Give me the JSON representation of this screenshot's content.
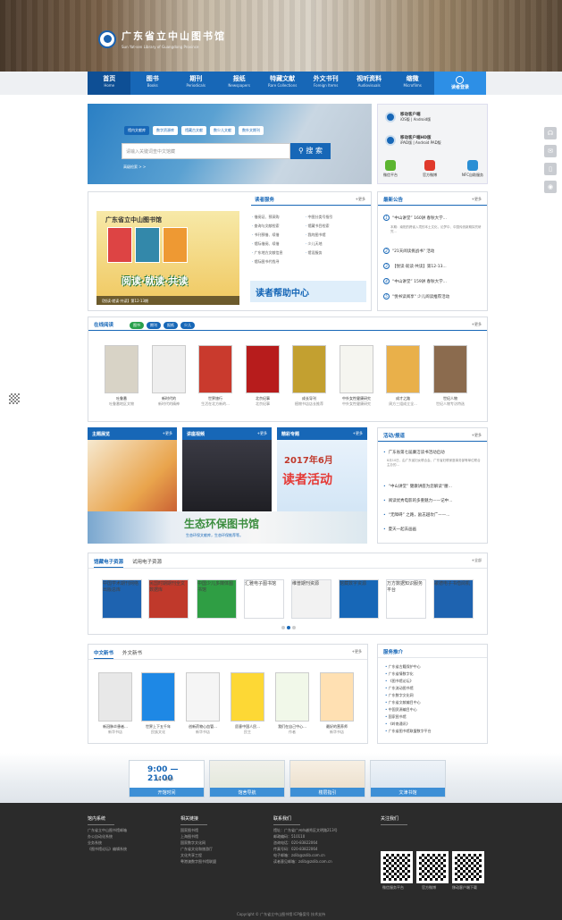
{
  "header": {
    "title": "广东省立中山图书馆",
    "subtitle": "Sun Yat-sen Library of Guangdong Province"
  },
  "nav": [
    {
      "cn": "首页",
      "en": "Home"
    },
    {
      "cn": "图书",
      "en": "Books"
    },
    {
      "cn": "期刊",
      "en": "Periodicals"
    },
    {
      "cn": "报纸",
      "en": "Newspapers"
    },
    {
      "cn": "特藏文献",
      "en": "Rare Collections"
    },
    {
      "cn": "外文书刊",
      "en": "Foreign Items"
    },
    {
      "cn": "视听资料",
      "en": "Audiovisuals"
    },
    {
      "cn": "缩微",
      "en": "Microfilms"
    },
    {
      "cn": "读者登录",
      "en": ""
    }
  ],
  "search": {
    "tabs": [
      "馆内文献库",
      "数字资源库",
      "馆藏古文献",
      "数少儿文献",
      "数外文期刊"
    ],
    "placeholder": "请输入关键词查中文馆藏",
    "button": "搜 索",
    "advanced": "高级检索 > >"
  },
  "mobile": {
    "phone_title": "移动客户端",
    "phone_sub": "iOS版 | Android版",
    "hd_title": "移动客户端HD版",
    "hd_sub": "iPAD版 | Android PAD版",
    "apps": [
      "微信平台",
      "官方微博",
      "NFC自助服务"
    ]
  },
  "reader_service": {
    "title": "读者服务",
    "more": "+更多",
    "banner_title": "广东省立中山图书馆",
    "banner_slogan": "阅读·就读·共读",
    "banner_caption": "【悦读·就读·共读】第12·13期",
    "links_left": [
      "借阅证、预采购",
      "查询与文献检索",
      "书刊预借、续借",
      "馆际借阅、续借",
      "广东地方文献信息",
      "馆际图书代找寻"
    ],
    "links_right": [
      "中图分类号指引",
      "馆藏书目检索",
      "我的图书馆",
      "少儿天地",
      "馆设服务"
    ],
    "help": "读者帮助中心"
  },
  "notices": {
    "title": "最新公告",
    "more": "+更多",
    "items": [
      "“中山讲堂” 160讲 春秋大学...",
      "\"21天阅读挑战书\" 活动",
      "【悦读·就读·共读】第12-13...",
      "“中山讲堂” 159讲 春秋大学...",
      "\"悦书读阅享\" 少儿阅读推荐活动"
    ],
    "snippet": "本期：南阳的跨省入境的本土文化，论梦中、中国传统新期探究研究..."
  },
  "online_reading": {
    "title": "在线阅读",
    "pills": [
      "图书",
      "期刊",
      "报纸",
      "少儿"
    ],
    "more": "+更多",
    "books": [
      {
        "t": "吐鲁番",
        "s": "吐鲁番地区文物"
      },
      {
        "t": "新时代的",
        "s": "新时代的精神"
      },
      {
        "t": "世界旅行",
        "s": "生活在北方新的..."
      },
      {
        "t": "北京纪事",
        "s": "北京纪事"
      },
      {
        "t": "成长导刊",
        "s": "植物书店店长推荐"
      },
      {
        "t": "中外女性健康研究",
        "s": "中外女性健康研究"
      },
      {
        "t": "成才之路",
        "s": "周方三组成立全..."
      },
      {
        "t": "世纪人物",
        "s": "世纪人物专访特选"
      }
    ]
  },
  "sections": {
    "theme": {
      "title": "主题展览",
      "more": "+更多",
      "caption": "喜迎新春——年画展示活动"
    },
    "video": {
      "title": "讲座视频",
      "more": "+更多",
      "time": "0:00"
    },
    "special": {
      "title": "精彩专题",
      "more": "+更多",
      "headline": "2017年6月",
      "big": "读者活动",
      "caption": "6月读者活动精彩推荐"
    },
    "eco": {
      "title": "生态环保图书馆",
      "sub": "生态环保文献库，生态环保推荐等。"
    }
  },
  "activities": {
    "title": "活动/报道",
    "more": "+更多",
    "items": [
      "广东省第七届廉洁读书活动启动",
      "“中山讲堂” 健康讲座为您解读“腰...",
      "阅读优秀电影的多重魅力——记中...",
      "“无障碍” 之路，励志越坎广——...",
      "夏天一起去画画"
    ],
    "snippet": "8月10日，由广东省妇女联合会、广东省妇联家庭事务部等单位联合主办的..."
  },
  "eresources": {
    "tabs": [
      "馆藏电子资源",
      "试用电子资源"
    ],
    "more": "+全部",
    "items": [
      "中国学术期刊网络出版总库",
      "民国时期期刊全文数据库",
      "中国少儿多媒体图书馆",
      "汇雅电子图书馆",
      "维普期刊资源",
      "馆藏数字资源",
      "万方数据知识服务平台",
      "歌德电子书借阅机"
    ]
  },
  "newbooks": {
    "tabs": [
      "中文新书",
      "外文新书"
    ],
    "more": "+更多",
    "items": [
      {
        "t": "新冠肺炎患者...",
        "s": "新华书店"
      },
      {
        "t": "世界上下五千年",
        "s": "民族文化"
      },
      {
        "t": "创新药物心血管...",
        "s": "新华书店"
      },
      {
        "t": "愿意中国人民...",
        "s": "民主"
      },
      {
        "t": "我们在自己中心...",
        "s": "作者"
      },
      {
        "t": "最好的营养师",
        "s": "新华书店"
      }
    ]
  },
  "services": {
    "title": "服务推介",
    "items": [
      "广东省古籍保护中心",
      "广东省情数字化",
      "《图书馆论坛》",
      "广东流动图书馆",
      "广东数字文化网",
      "广东省文献编目中心",
      "中国资源编目中心",
      "国家图书馆",
      "《岭南通讯》",
      "广东省图书馆联盟数字平台"
    ]
  },
  "tiles": [
    {
      "label": "开馆时间",
      "time": "9:00 — 21:00",
      "note": "(周一闭馆)"
    },
    {
      "label": "馆舍导航"
    },
    {
      "label": "楼层指引"
    },
    {
      "label": "文津书馆"
    }
  ],
  "footer": {
    "col1_title": "馆内系统",
    "col1": [
      "广东省立中山图书馆邮箱",
      "办公自动化系统",
      "业务系统",
      "《图书馆论坛》编辑系统"
    ],
    "col2_title": "相关链接",
    "col2": [
      "国家图书馆",
      "上海图书馆",
      "国家数字文化网",
      "广东省文化和旅游厅",
      "文化共享工程",
      "粤港澳数字图书馆联盟"
    ],
    "col3_title": "联系我们",
    "col3": [
      "馆址：广东省广州市越秀区文明路213号",
      "邮政编码：510110",
      "咨询电话：020-83822064",
      "传真号码：020-83822064",
      "电子邮箱：zslib@zslib.com.cn",
      "读者意见邮箱：zslib@zslib.com.cn"
    ],
    "col4_title": "关注我们",
    "qr": [
      "微信服务平台",
      "官方微博",
      "移动客户端下载"
    ],
    "copyright": "Copyright © 广东省立中山图书馆  ICP备案号  技术支持"
  }
}
